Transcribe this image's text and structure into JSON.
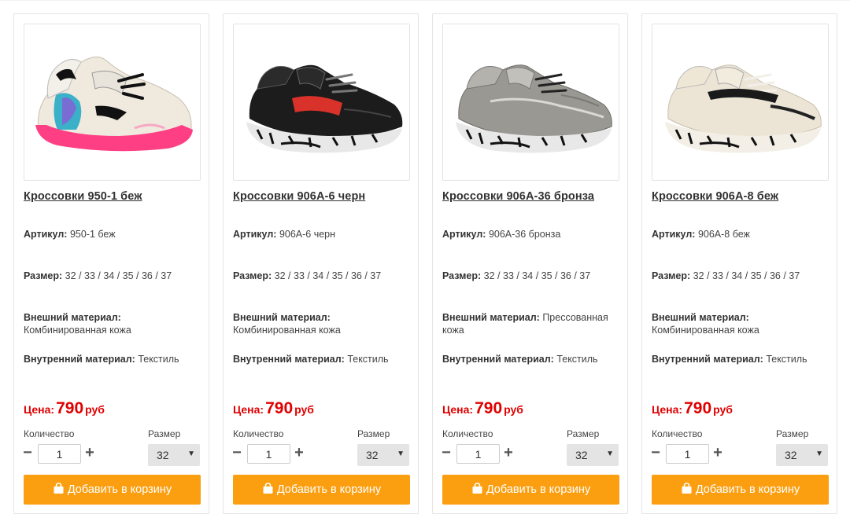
{
  "labels": {
    "article": "Артикул:",
    "size": "Размер:",
    "outer_material": "Внешний материал:",
    "inner_material": "Внутренний материал:",
    "price": "Цена:",
    "currency": "руб",
    "quantity": "Количество",
    "size_select": "Размер",
    "add_to_cart": "Добавить в корзину"
  },
  "colors": {
    "price_red": "#e00000",
    "button_orange": "#fb9f11"
  },
  "products": [
    {
      "title": "Кроссовки 950-1 беж",
      "article": "950-1 беж",
      "sizes": "32 / 33 / 34 / 35 / 36 / 37",
      "outer_material": "Комбинированная кожа",
      "inner_material": "Текстиль",
      "price": "790",
      "quantity": "1",
      "selected_size": "32",
      "image": "beige-pink-sneaker"
    },
    {
      "title": "Кроссовки 906А-6 черн",
      "article": "906А-6 черн",
      "sizes": "32 / 33 / 34 / 35 / 36 / 37",
      "outer_material": "Комбинированная кожа",
      "inner_material": "Текстиль",
      "price": "790",
      "quantity": "1",
      "selected_size": "32",
      "image": "black-sneaker"
    },
    {
      "title": "Кроссовки 906А-36 бронза",
      "article": "906А-36 бронза",
      "sizes": "32 / 33 / 34 / 35 / 36 / 37",
      "outer_material": "Прессованная кожа",
      "inner_material": "Текстиль",
      "price": "790",
      "quantity": "1",
      "selected_size": "32",
      "image": "bronze-sneaker"
    },
    {
      "title": "Кроссовки 906А-8 беж",
      "article": "906А-8 беж",
      "sizes": "32 / 33 / 34 / 35 / 36 / 37",
      "outer_material": "Комбинированная кожа",
      "inner_material": "Текстиль",
      "price": "790",
      "quantity": "1",
      "selected_size": "32",
      "image": "beige-sneaker"
    }
  ]
}
